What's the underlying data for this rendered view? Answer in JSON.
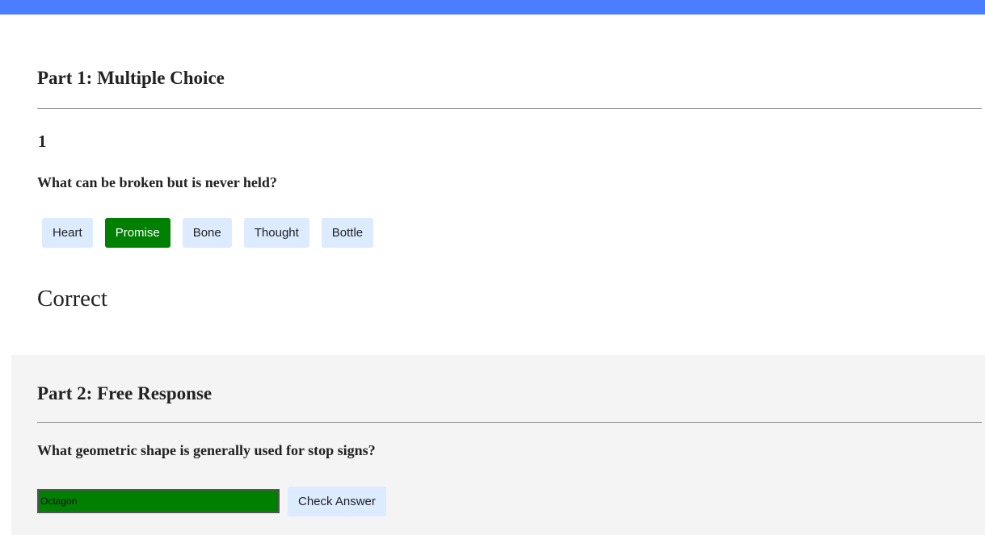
{
  "part1": {
    "title": "Part 1: Multiple Choice",
    "question_number": "1",
    "question": "What can be broken but is never held?",
    "choices": [
      {
        "label": "Heart",
        "state": "default"
      },
      {
        "label": "Promise",
        "state": "selected-correct"
      },
      {
        "label": "Bone",
        "state": "default"
      },
      {
        "label": "Thought",
        "state": "default"
      },
      {
        "label": "Bottle",
        "state": "default"
      }
    ],
    "result": "Correct"
  },
  "part2": {
    "title": "Part 2: Free Response",
    "question": "What geometric shape is generally used for stop signs?",
    "answer_value": "Octagon",
    "check_label": "Check Answer"
  },
  "colors": {
    "top_bar": "#4a7dff",
    "correct": "#008000",
    "choice_bg": "#dcebff",
    "part2_bg": "#f4f4f4"
  }
}
